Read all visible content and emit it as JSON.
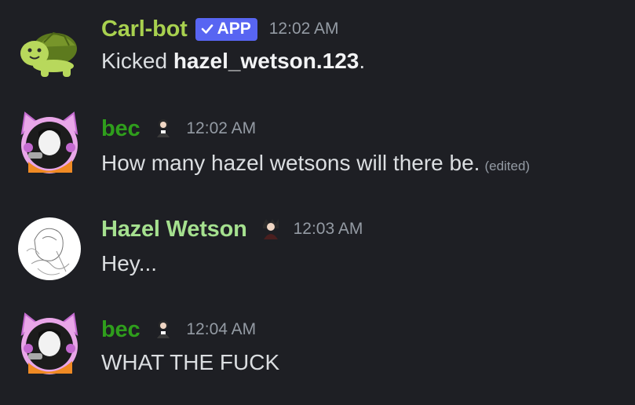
{
  "messages": [
    {
      "username": "Carl-bot",
      "username_color": "#a8d14f",
      "badge": "APP",
      "timestamp": "12:02 AM",
      "text_prefix": "Kicked ",
      "text_bold": "hazel_wetson.123",
      "text_suffix": ".",
      "avatar_icon": "turtle-icon"
    },
    {
      "username": "bec",
      "username_color": "#2f9e1c",
      "role_icon": "figure-icon",
      "timestamp": "12:02 AM",
      "text": "How many hazel wetsons will there be.",
      "edited_label": "(edited)",
      "avatar_icon": "cat-ear-headphones-avatar"
    },
    {
      "username": "Hazel Wetson",
      "username_color": "#a5e08f",
      "role_icon": "figure-icon",
      "timestamp": "12:03 AM",
      "text": "Hey...",
      "avatar_icon": "sketch-avatar"
    },
    {
      "username": "bec",
      "username_color": "#2f9e1c",
      "role_icon": "figure-icon",
      "timestamp": "12:04 AM",
      "text": "WHAT THE FUCK",
      "avatar_icon": "cat-ear-headphones-avatar"
    }
  ]
}
